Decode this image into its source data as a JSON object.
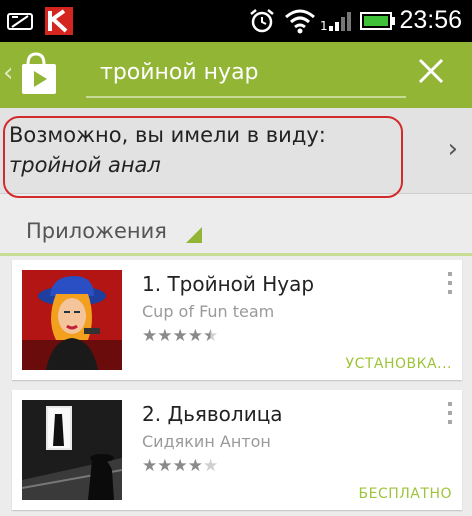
{
  "status_bar": {
    "time": "23:56",
    "icons": [
      "screenshot-icon",
      "antivirus-icon",
      "alarm-icon",
      "wifi-icon",
      "signal-icon",
      "battery-icon"
    ]
  },
  "action_bar": {
    "search_query": "тройной нуар",
    "icons": [
      "back-chevron-icon",
      "play-store-icon",
      "close-icon"
    ]
  },
  "suggestion": {
    "prompt": "Возможно, вы имели в виду:",
    "text": "тройной анал"
  },
  "section": {
    "title": "Приложения"
  },
  "apps": [
    {
      "title": "1. Тройной Нуар",
      "developer": "Cup of Fun team",
      "rating": 4.5,
      "action": "УСТАНОВКА..."
    },
    {
      "title": "2. Дьяволица",
      "developer": "Сидякин Антон",
      "rating": 4,
      "action": "БЕСПЛАТНО"
    }
  ],
  "colors": {
    "action_bar": "#93b536",
    "accent": "#9ec43a",
    "highlight_border": "#d22b2b"
  }
}
